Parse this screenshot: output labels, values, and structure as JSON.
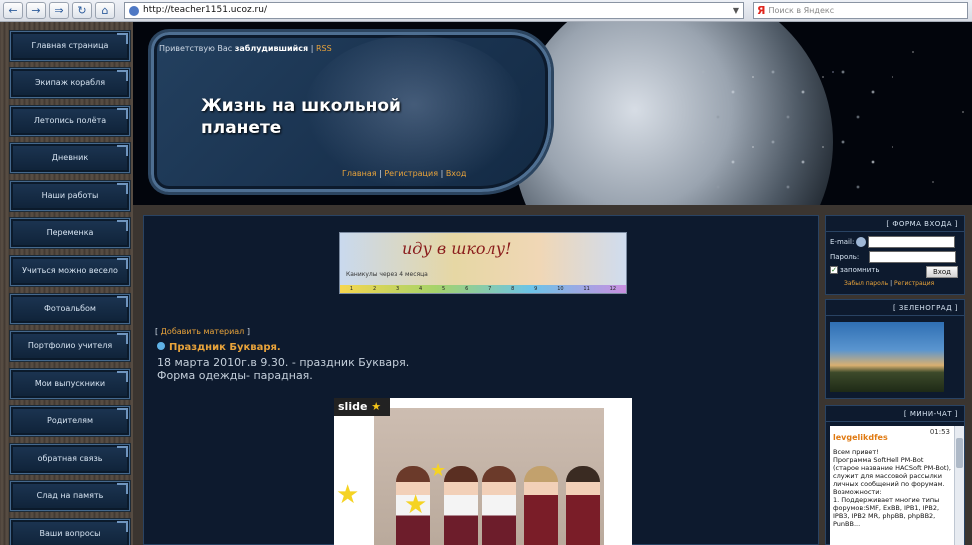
{
  "browser": {
    "url": "http://teacher1151.ucoz.ru/",
    "search_placeholder": "Поиск в Яндекс",
    "yandex_logo": "Я"
  },
  "menu": [
    "Главная страница",
    "Экипаж корабля",
    "Летопись полёта",
    "Дневник",
    "Наши работы",
    "Переменка",
    "Учиться можно весело",
    "Фотоальбом",
    "Портфолио учителя",
    "Мои выпускники",
    "Родителям",
    "обратная связь",
    "Слад на память",
    "Ваши вопросы"
  ],
  "header": {
    "greeting_prefix": "Приветствую Вас",
    "greeting_user": "заблудившийся",
    "greeting_sep": "|",
    "rss": "RSS",
    "title": "Жизнь на школьной планете",
    "link_home": "Главная",
    "link_register": "Регистрация",
    "link_login": "Вход",
    "sep": "|"
  },
  "banner": {
    "text": "иду в школу!",
    "caption": "Каникулы через 4 месяца",
    "ruler": [
      "1",
      "2",
      "3",
      "4",
      "5",
      "6",
      "7",
      "8",
      "9",
      "10",
      "11",
      "12"
    ]
  },
  "post": {
    "add_material_open": "[",
    "add_material": "Добавить материал",
    "add_material_close": "]",
    "title": "Праздник Букваря.",
    "line1": "18 марта 2010г.в 9.30. - праздник Букваря.",
    "line2": "Форма одежды- парадная.",
    "slide_label": "slide",
    "slide_star": "★"
  },
  "login_box": {
    "title": "[ ФОРМА ВХОДА ]",
    "email_label": "E-mail:",
    "password_label": "Пароль:",
    "remember": "запомнить",
    "submit": "Вход",
    "forgot": "Забыл пароль",
    "register": "Регистрация",
    "sep": "|"
  },
  "zelenograd_box": {
    "title": "[ ЗЕЛЕНОГРАД ]"
  },
  "chat_box": {
    "title": "[ МИНИ-ЧАТ ]",
    "user": "levgelikdfes",
    "time": "01:53",
    "message": "Всем привет!\nПрограмма SoftHell PM-Bot (старое название HACSoft PM-Bot), служит для массовой рассылки личных сообщений по форумам.\nВозможности:\n1. Поддерживает многие типы форумов:SMF, ExBB, IPB1, IPB2, IPB3, IPB2 MR, phpBB, phpBB2, PunBB..."
  }
}
